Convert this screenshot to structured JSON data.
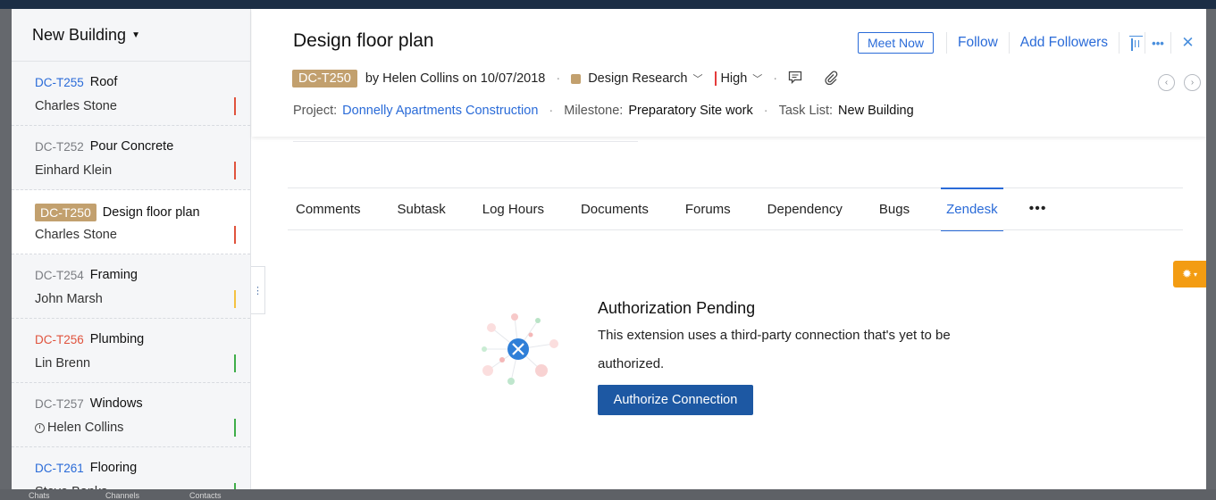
{
  "background": {
    "bottom_labels": [
      "Chats",
      "Channels",
      "Contacts"
    ]
  },
  "list": {
    "header": "New Building",
    "items": [
      {
        "id": "DC-T255",
        "title": "Roof",
        "owner": "Charles Stone",
        "id_style": "blue",
        "priority_color": "#e0533d",
        "clock": false
      },
      {
        "id": "DC-T252",
        "title": "Pour Concrete",
        "owner": "Einhard Klein",
        "id_style": "gray",
        "priority_color": "#e0533d",
        "clock": false
      },
      {
        "id": "DC-T250",
        "title": "Design floor plan",
        "owner": "Charles Stone",
        "id_style": "pill",
        "priority_color": "#e0533d",
        "clock": false
      },
      {
        "id": "DC-T254",
        "title": "Framing",
        "owner": "John Marsh",
        "id_style": "gray",
        "priority_color": "#f4c242",
        "clock": false
      },
      {
        "id": "DC-T256",
        "title": "Plumbing",
        "owner": "Lin Brenn",
        "id_style": "red",
        "priority_color": "#3fae49",
        "clock": false
      },
      {
        "id": "DC-T257",
        "title": "Windows",
        "owner": "Helen Collins",
        "id_style": "gray",
        "priority_color": "#3fae49",
        "clock": true
      },
      {
        "id": "DC-T261",
        "title": "Flooring",
        "owner": "Steve Banks",
        "id_style": "blue",
        "priority_color": "#3fae49",
        "clock": false
      }
    ]
  },
  "detail": {
    "title": "Design floor plan",
    "actions": {
      "meet_now": "Meet Now",
      "follow": "Follow",
      "add_followers": "Add Followers",
      "more": "•••",
      "close": "✕"
    },
    "meta": {
      "task_id": "DC-T250",
      "created_by": "by Helen Collins on 10/07/2018",
      "category": "Design Research",
      "priority": "High"
    },
    "project_line": {
      "project_label": "Project:",
      "project_value": "Donnelly Apartments Construction",
      "milestone_label": "Milestone:",
      "milestone_value": "Preparatory Site work",
      "tasklist_label": "Task List:",
      "tasklist_value": "New Building"
    },
    "tabs": [
      "Comments",
      "Subtask",
      "Log Hours",
      "Documents",
      "Forums",
      "Dependency",
      "Bugs",
      "Zendesk"
    ],
    "active_tab": "Zendesk",
    "tabs_more": "•••",
    "empty_state": {
      "title": "Authorization Pending",
      "text": "This extension uses a third-party connection that's yet to be authorized.",
      "button": "Authorize Connection"
    }
  },
  "colors": {
    "accent": "#2a6bd8",
    "primary_button": "#1d58a3",
    "tag": "#c2a06e",
    "side_tool": "#f39c12"
  }
}
